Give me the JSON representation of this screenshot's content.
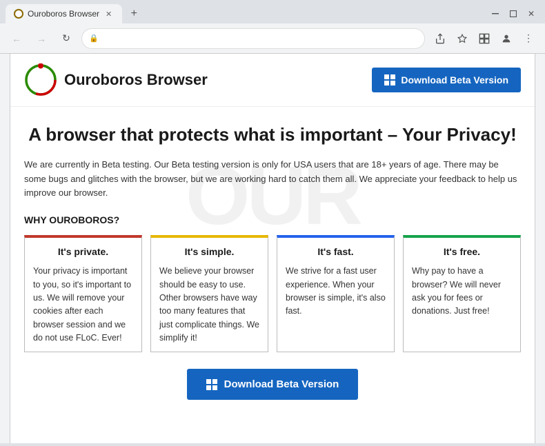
{
  "browser": {
    "tab": {
      "title": "Ouroboros Browser",
      "favicon_alt": "ouroboros-favicon"
    },
    "window_controls": {
      "minimize": "—",
      "maximize": "□",
      "close": "✕"
    },
    "nav": {
      "back": "←",
      "forward": "→",
      "reload": "↻"
    },
    "address": "",
    "lock_icon": "🔒",
    "toolbar": {
      "share": "⬆",
      "bookmark": "☆",
      "extension": "□",
      "profile": "👤",
      "menu": "⋮"
    },
    "new_tab_plus": "+"
  },
  "site": {
    "header": {
      "logo_text": "Ouroboros Browser",
      "download_btn": "Download Beta Version"
    },
    "hero": {
      "title": "A browser that protects what is important – Your Privacy!",
      "description": "We are currently in Beta testing. Our Beta testing version is only for USA users that are 18+ years of age. There may be some bugs and glitches with the browser, but we are working hard to catch them all. We appreciate your feedback to help us improve our browser."
    },
    "why_heading": "WHY OUROBOROS?",
    "cards": [
      {
        "title": "It's private.",
        "body": "Your privacy is important to you, so it's important to us. We will remove your cookies after each browser session and we do not use FLoC. Ever!",
        "border": "red-top"
      },
      {
        "title": "It's simple.",
        "body": "We believe your browser should be easy to use. Other browsers have way too many features that just complicate things. We simplify it!",
        "border": "yellow-top"
      },
      {
        "title": "It's fast.",
        "body": "We strive for a fast user experience. When your browser is simple, it's also fast.",
        "border": "blue-top"
      },
      {
        "title": "It's free.",
        "body": "Why pay to have a browser? We will never ask you for fees or donations. Just free!",
        "border": "green-top"
      }
    ],
    "download_main": "Download Beta Version",
    "watermark": "OUR"
  }
}
